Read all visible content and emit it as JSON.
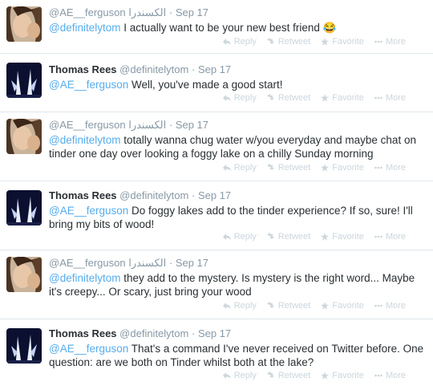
{
  "tweets": [
    {
      "author": "ae",
      "display_name": "",
      "username": "@AE__ferguson",
      "arabic_name": "الكسندرا",
      "separator": "·",
      "time": "Sep 17",
      "mention": "@definitelytom",
      "text": " I actually want to be your new best friend 😂",
      "text_full": "@definitelytom I actually want to be your new best friend 😂"
    },
    {
      "author": "tom",
      "display_name": "Thomas Rees",
      "username": "@definitelytom",
      "arabic_name": "",
      "separator": "·",
      "time": "Sep 17",
      "mention": "@AE__ferguson",
      "text": " Well, you've made a good start!"
    },
    {
      "author": "ae",
      "display_name": "",
      "username": "@AE__ferguson",
      "arabic_name": "الكسندرا",
      "separator": "·",
      "time": "Sep 17",
      "mention": "@definitelytom",
      "text": " totally wanna chug water w/you everyday and maybe chat on tinder one day over looking a foggy lake on a chilly Sunday morning"
    },
    {
      "author": "tom",
      "display_name": "Thomas Rees",
      "username": "@definitelytom",
      "arabic_name": "",
      "separator": "·",
      "time": "Sep 17",
      "mention": "@AE__ferguson",
      "text": " Do foggy lakes add to the tinder experience? If so, sure! I'll bring my bits of wood!"
    },
    {
      "author": "ae",
      "display_name": "",
      "username": "@AE__ferguson",
      "arabic_name": "الكسندرا",
      "separator": "·",
      "time": "Sep 17",
      "mention": "@definitelytom",
      "text": " they add to the mystery. Is mystery is the right word... Maybe it's creepy... Or scary, just bring your wood"
    },
    {
      "author": "tom",
      "display_name": "Thomas Rees",
      "username": "@definitelytom",
      "arabic_name": "",
      "separator": "·",
      "time": "Sep 17",
      "mention": "@AE__ferguson",
      "text": " That's a command I've never received on Twitter before. One question: are we both on Tinder whilst both at the lake?"
    }
  ],
  "actions": {
    "reply": "Reply",
    "retweet": "Retweet",
    "favorite": "Favorite",
    "more": "More"
  },
  "colors": {
    "link": "#55acee",
    "meta": "#8899a6",
    "action": "#ccd6dd"
  }
}
